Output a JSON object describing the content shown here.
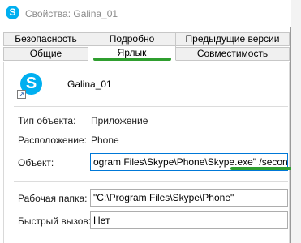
{
  "window": {
    "title": "Свойства: Galina_01",
    "icon": "skype-icon"
  },
  "tabs_row1": [
    {
      "label": "Безопасность"
    },
    {
      "label": "Подробно"
    },
    {
      "label": "Предыдущие версии"
    }
  ],
  "tabs_row2": [
    {
      "label": "Общие"
    },
    {
      "label": "Ярлык",
      "active": true
    },
    {
      "label": "Совместимость"
    }
  ],
  "shortcut": {
    "name": "Galina_01",
    "icon": "skype-icon",
    "overlay_icon": "shortcut-arrow-icon"
  },
  "props": {
    "type_label": "Тип объекта:",
    "type_value": "Приложение",
    "location_label": "Расположение:",
    "location_value": "Phone",
    "target_label": "Объект:",
    "target_value": "ogram Files\\Skype\\Phone\\Skype.exe\" /secondary",
    "workdir_label": "Рабочая папка:",
    "workdir_value": "\"C:\\Program Files\\Skype\\Phone\"",
    "hotkey_label": "Быстрый вызов:",
    "hotkey_value": "Нет"
  },
  "colors": {
    "accent_green": "#2f9e2f",
    "skype_blue": "#00aff0",
    "focus_border": "#0078d7"
  }
}
